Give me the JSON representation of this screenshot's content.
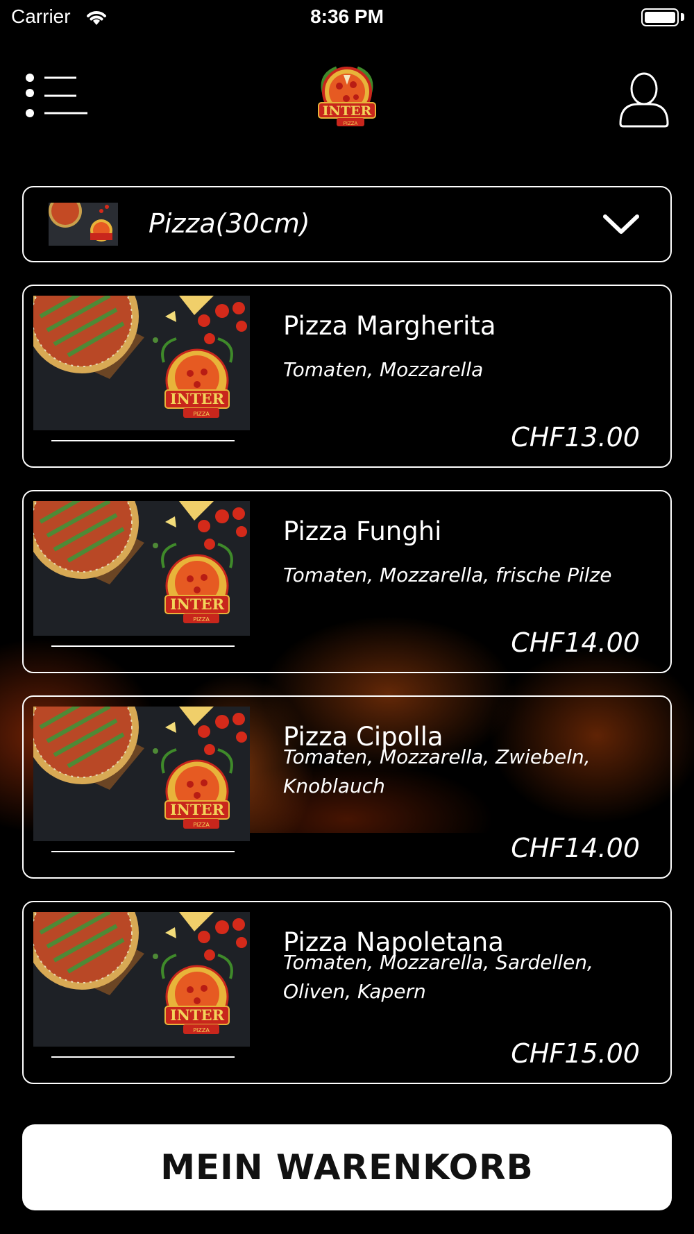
{
  "status_bar": {
    "carrier": "Carrier",
    "time": "8:36 PM"
  },
  "header": {
    "menu_icon": "list-menu-icon",
    "profile_icon": "user-profile-icon",
    "logo_icon": "inter-pizza-logo"
  },
  "category": {
    "label": "Pizza(30cm)",
    "icon": "chevron-down-icon"
  },
  "products": [
    {
      "title": "Pizza Margherita",
      "description": "Tomaten, Mozzarella",
      "price": "CHF13.00"
    },
    {
      "title": "Pizza Funghi",
      "description": "Tomaten, Mozzarella, frische Pilze",
      "price": "CHF14.00"
    },
    {
      "title": "Pizza Cipolla",
      "description": "Tomaten, Mozzarella, Zwiebeln, Knoblauch",
      "price": "CHF14.00"
    },
    {
      "title": "Pizza Napoletana",
      "description": "Tomaten, Mozzarella, Sardellen, Oliven, Kapern",
      "price": "CHF15.00"
    }
  ],
  "cart": {
    "label": "MEIN WARENKORB"
  },
  "colors": {
    "background": "#000000",
    "border": "#ffffff",
    "button_bg": "#ffffff",
    "button_text": "#111111",
    "logo_red": "#c8261c",
    "logo_gold": "#e8b43a"
  }
}
